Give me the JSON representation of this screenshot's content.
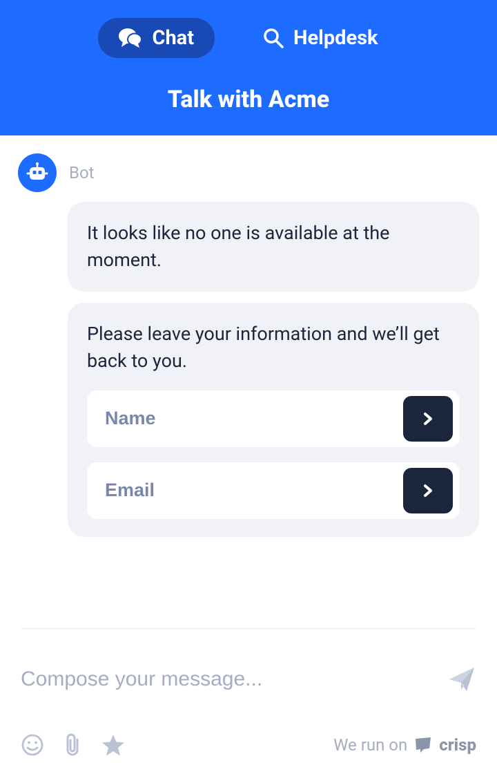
{
  "header": {
    "tabs": {
      "chat": "Chat",
      "helpdesk": "Helpdesk"
    },
    "title": "Talk with Acme"
  },
  "sender": {
    "name": "Bot"
  },
  "messages": {
    "m1": "It looks like no one is available at the moment.",
    "m2": "Please leave your information and we’ll get back to you."
  },
  "form": {
    "name_placeholder": "Name",
    "email_placeholder": "Email"
  },
  "compose": {
    "placeholder": "Compose your message..."
  },
  "branding": {
    "prefix": "We run on",
    "name": "crisp"
  }
}
